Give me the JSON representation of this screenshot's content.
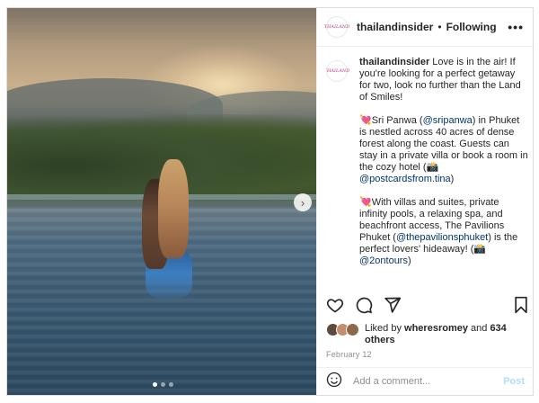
{
  "post": {
    "username": "thailandinsider",
    "separator": "•",
    "follow_status": "Following",
    "more_icon": "•••",
    "avatar_logo": "THAILAND",
    "caption": {
      "username": "thailandinsider",
      "p1_text": " Love is in the air! If you're looking for a perfect getaway for two, look no further than the Land of Smiles!",
      "p2_heart": "💘",
      "p2_a": "Sri Panwa (",
      "p2_mention1": "@sripanwa",
      "p2_b": ") in Phuket is nestled across 40 acres of dense forest along the coast. Guests can stay in a private villa or book a room in the cozy hotel (📸 ",
      "p2_mention2": "@postcardsfrom.tina",
      "p2_c": ")",
      "p3_heart": "💘",
      "p3_a": "With villas and suites, private infinity pools, a relaxing spa, and beachfront access, The Pavilions Phuket (",
      "p3_mention1": "@thepavilionsphuket",
      "p3_b": ") is the perfect lovers' hideaway! (📸 ",
      "p3_mention2": "@2ontours",
      "p3_c": ")"
    },
    "likes": {
      "prefix": "Liked by ",
      "user": "wheresromey",
      "middle": " and ",
      "count": "634 others"
    },
    "date": "February 12",
    "comment": {
      "placeholder": "Add a comment...",
      "post_label": "Post"
    },
    "carousel": {
      "next_glyph": "›",
      "slide_count": 3,
      "active_index": 0
    }
  },
  "colors": {
    "mention": "#00376b",
    "post_button": "#b3dbff",
    "secondary_text": "#8e8e8e"
  },
  "icons": [
    "heart-icon",
    "comment-icon",
    "share-icon",
    "bookmark-icon",
    "smiley-icon",
    "more-options-icon",
    "chevron-right-icon"
  ]
}
